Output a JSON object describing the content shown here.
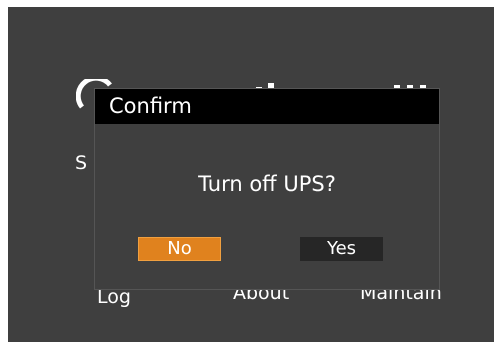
{
  "dialog": {
    "title": "Confirm",
    "message": "Turn off UPS?",
    "buttons": {
      "no_label": "No",
      "yes_label": "Yes",
      "selected": "No"
    }
  },
  "background_menu": {
    "items": [
      {
        "label": "Log",
        "icon": "log-icon"
      },
      {
        "label": "About",
        "icon": "about-icon"
      },
      {
        "label": "Maintain",
        "icon": "maintain-icon"
      }
    ],
    "partial_text": "S"
  },
  "colors": {
    "screen_bg": "#3f3f3f",
    "titlebar_bg": "#000000",
    "selected_button": "#e0821e",
    "unselected_button": "#262626"
  }
}
